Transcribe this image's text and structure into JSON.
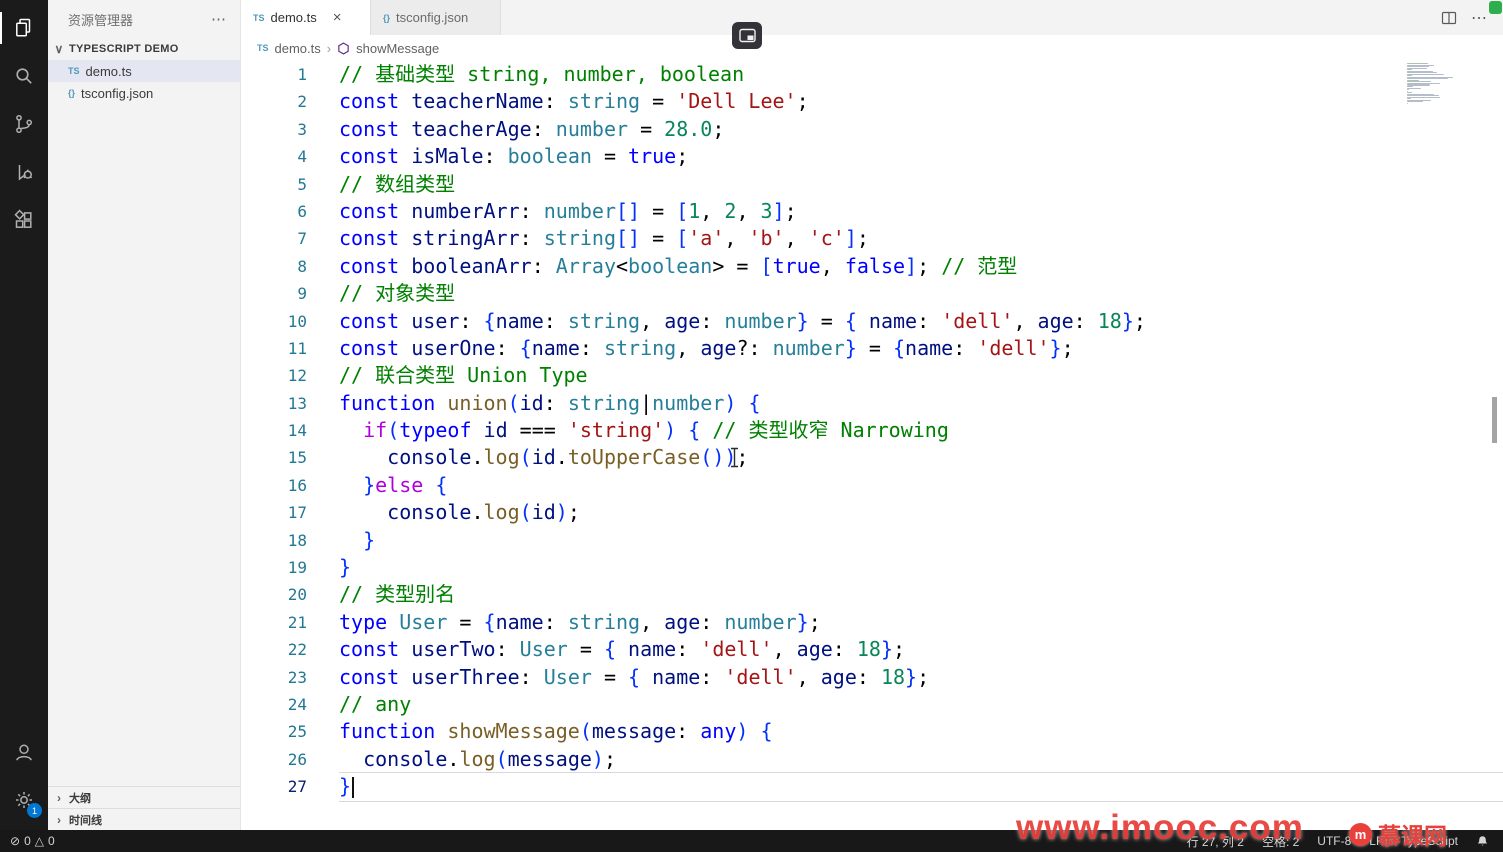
{
  "icons": {
    "ts": "TS",
    "json": "{}",
    "close": "×",
    "more": "⋯",
    "chevron_down": "∨",
    "chevron_right": "›",
    "breadcrumb_sep": "›",
    "error": "⊘",
    "warning": "△",
    "logo_glyph": "m"
  },
  "colors": {
    "seti_blue": "#519aba",
    "badge_blue": "#0078d4",
    "selection": "#e4e6f1",
    "watermark_red": "#e8413c"
  },
  "activity_bar": {
    "settings_badge": "1"
  },
  "sidebar": {
    "title": "资源管理器",
    "section": "TYPESCRIPT DEMO",
    "files": [
      {
        "label": "demo.ts"
      },
      {
        "label": "tsconfig.json"
      }
    ],
    "panels": [
      {
        "label": "大纲"
      },
      {
        "label": "时间线"
      }
    ]
  },
  "tabs": [
    {
      "label": "demo.ts"
    },
    {
      "label": "tsconfig.json"
    }
  ],
  "breadcrumb": {
    "file": "demo.ts",
    "symbol": "showMessage"
  },
  "editor": {
    "cursor": {
      "line": 27,
      "col": 2
    },
    "lines": [
      [
        [
          "// 基础类型 string, number, boolean",
          "c"
        ]
      ],
      [
        [
          "const",
          "k"
        ],
        [
          " "
        ],
        [
          "teacherName",
          "v"
        ],
        [
          ": "
        ],
        [
          "string",
          "t"
        ],
        [
          " = "
        ],
        [
          "'Dell Lee'",
          "s"
        ],
        [
          ";"
        ]
      ],
      [
        [
          "const",
          "k"
        ],
        [
          " "
        ],
        [
          "teacherAge",
          "v"
        ],
        [
          ": "
        ],
        [
          "number",
          "t"
        ],
        [
          " = "
        ],
        [
          "28.0",
          "n"
        ],
        [
          ";"
        ]
      ],
      [
        [
          "const",
          "k"
        ],
        [
          " "
        ],
        [
          "isMale",
          "v"
        ],
        [
          ": "
        ],
        [
          "boolean",
          "t"
        ],
        [
          " = "
        ],
        [
          "true",
          "k"
        ],
        [
          ";"
        ]
      ],
      [
        [
          "// 数组类型",
          "c"
        ]
      ],
      [
        [
          "const",
          "k"
        ],
        [
          " "
        ],
        [
          "numberArr",
          "v"
        ],
        [
          ": "
        ],
        [
          "number",
          "t"
        ],
        [
          "[]",
          "b"
        ],
        [
          " = "
        ],
        [
          "[",
          "b"
        ],
        [
          "1",
          "n"
        ],
        [
          ", "
        ],
        [
          "2",
          "n"
        ],
        [
          ", "
        ],
        [
          "3",
          "n"
        ],
        [
          "]",
          "b"
        ],
        [
          ";"
        ]
      ],
      [
        [
          "const",
          "k"
        ],
        [
          " "
        ],
        [
          "stringArr",
          "v"
        ],
        [
          ": "
        ],
        [
          "string",
          "t"
        ],
        [
          "[]",
          "b"
        ],
        [
          " = "
        ],
        [
          "[",
          "b"
        ],
        [
          "'a'",
          "s"
        ],
        [
          ", "
        ],
        [
          "'b'",
          "s"
        ],
        [
          ", "
        ],
        [
          "'c'",
          "s"
        ],
        [
          "]",
          "b"
        ],
        [
          ";"
        ]
      ],
      [
        [
          "const",
          "k"
        ],
        [
          " "
        ],
        [
          "booleanArr",
          "v"
        ],
        [
          ": "
        ],
        [
          "Array",
          "t"
        ],
        [
          "<"
        ],
        [
          "boolean",
          "t"
        ],
        [
          "> = "
        ],
        [
          "[",
          "b"
        ],
        [
          "true",
          "k"
        ],
        [
          ", "
        ],
        [
          "false",
          "k"
        ],
        [
          "]",
          "b"
        ],
        [
          "; "
        ],
        [
          "// 范型",
          "c"
        ]
      ],
      [
        [
          "// 对象类型",
          "c"
        ]
      ],
      [
        [
          "const",
          "k"
        ],
        [
          " "
        ],
        [
          "user",
          "v"
        ],
        [
          ": "
        ],
        [
          "{",
          "b"
        ],
        [
          "name",
          "v"
        ],
        [
          ": "
        ],
        [
          "string",
          "t"
        ],
        [
          ", "
        ],
        [
          "age",
          "v"
        ],
        [
          ": "
        ],
        [
          "number",
          "t"
        ],
        [
          "}",
          "b"
        ],
        [
          " = "
        ],
        [
          "{",
          "b"
        ],
        [
          " "
        ],
        [
          "name",
          "v"
        ],
        [
          ": "
        ],
        [
          "'dell'",
          "s"
        ],
        [
          ", "
        ],
        [
          "age",
          "v"
        ],
        [
          ": "
        ],
        [
          "18",
          "n"
        ],
        [
          "}",
          "b"
        ],
        [
          ";"
        ]
      ],
      [
        [
          "const",
          "k"
        ],
        [
          " "
        ],
        [
          "userOne",
          "v"
        ],
        [
          ": "
        ],
        [
          "{",
          "b"
        ],
        [
          "name",
          "v"
        ],
        [
          ": "
        ],
        [
          "string",
          "t"
        ],
        [
          ", "
        ],
        [
          "age",
          "v"
        ],
        [
          "?: "
        ],
        [
          "number",
          "t"
        ],
        [
          "}",
          "b"
        ],
        [
          " = "
        ],
        [
          "{",
          "b"
        ],
        [
          "name",
          "v"
        ],
        [
          ": "
        ],
        [
          "'dell'",
          "s"
        ],
        [
          "}",
          "b"
        ],
        [
          ";"
        ]
      ],
      [
        [
          "// 联合类型 Union Type",
          "c"
        ]
      ],
      [
        [
          "function",
          "k"
        ],
        [
          " "
        ],
        [
          "union",
          "f"
        ],
        [
          "(",
          "b"
        ],
        [
          "id",
          "v"
        ],
        [
          ": "
        ],
        [
          "string",
          "t"
        ],
        [
          "|"
        ],
        [
          "number",
          "t"
        ],
        [
          ")",
          "b"
        ],
        [
          " "
        ],
        [
          "{",
          "b"
        ]
      ],
      [
        [
          "  "
        ],
        [
          "if",
          "o"
        ],
        [
          "(",
          "b"
        ],
        [
          "typeof",
          "k"
        ],
        [
          " "
        ],
        [
          "id",
          "v"
        ],
        [
          " === "
        ],
        [
          "'string'",
          "s"
        ],
        [
          ")",
          "b"
        ],
        [
          " "
        ],
        [
          "{",
          "b"
        ],
        [
          " "
        ],
        [
          "// 类型收窄 Narrowing",
          "c"
        ]
      ],
      [
        [
          "    "
        ],
        [
          "console",
          "v"
        ],
        [
          "."
        ],
        [
          "log",
          "f"
        ],
        [
          "(",
          "b"
        ],
        [
          "id",
          "v"
        ],
        [
          "."
        ],
        [
          "toUpperCase",
          "f"
        ],
        [
          "()",
          "b"
        ],
        [
          ")",
          "b"
        ],
        [
          ";"
        ]
      ],
      [
        [
          "  "
        ],
        [
          "}",
          "b"
        ],
        [
          "else",
          "o"
        ],
        [
          " "
        ],
        [
          "{",
          "b"
        ]
      ],
      [
        [
          "    "
        ],
        [
          "console",
          "v"
        ],
        [
          "."
        ],
        [
          "log",
          "f"
        ],
        [
          "(",
          "b"
        ],
        [
          "id",
          "v"
        ],
        [
          ")",
          "b"
        ],
        [
          ";"
        ]
      ],
      [
        [
          "  "
        ],
        [
          "}",
          "b"
        ]
      ],
      [
        [
          "}",
          "b"
        ]
      ],
      [
        [
          "// 类型别名",
          "c"
        ]
      ],
      [
        [
          "type",
          "k"
        ],
        [
          " "
        ],
        [
          "User",
          "t"
        ],
        [
          " = "
        ],
        [
          "{",
          "b"
        ],
        [
          "name",
          "v"
        ],
        [
          ": "
        ],
        [
          "string",
          "t"
        ],
        [
          ", "
        ],
        [
          "age",
          "v"
        ],
        [
          ": "
        ],
        [
          "number",
          "t"
        ],
        [
          "}",
          "b"
        ],
        [
          ";"
        ]
      ],
      [
        [
          "const",
          "k"
        ],
        [
          " "
        ],
        [
          "userTwo",
          "v"
        ],
        [
          ": "
        ],
        [
          "User",
          "t"
        ],
        [
          " = "
        ],
        [
          "{",
          "b"
        ],
        [
          " "
        ],
        [
          "name",
          "v"
        ],
        [
          ": "
        ],
        [
          "'dell'",
          "s"
        ],
        [
          ", "
        ],
        [
          "age",
          "v"
        ],
        [
          ": "
        ],
        [
          "18",
          "n"
        ],
        [
          "}",
          "b"
        ],
        [
          ";"
        ]
      ],
      [
        [
          "const",
          "k"
        ],
        [
          " "
        ],
        [
          "userThree",
          "v"
        ],
        [
          ": "
        ],
        [
          "User",
          "t"
        ],
        [
          " = "
        ],
        [
          "{",
          "b"
        ],
        [
          " "
        ],
        [
          "name",
          "v"
        ],
        [
          ": "
        ],
        [
          "'dell'",
          "s"
        ],
        [
          ", "
        ],
        [
          "age",
          "v"
        ],
        [
          ": "
        ],
        [
          "18",
          "n"
        ],
        [
          "}",
          "b"
        ],
        [
          ";"
        ]
      ],
      [
        [
          "// any",
          "c"
        ]
      ],
      [
        [
          "function",
          "k"
        ],
        [
          " "
        ],
        [
          "showMessage",
          "f"
        ],
        [
          "(",
          "b"
        ],
        [
          "message",
          "v"
        ],
        [
          ": "
        ],
        [
          "any",
          "k"
        ],
        [
          ")",
          "b"
        ],
        [
          " "
        ],
        [
          "{",
          "b"
        ]
      ],
      [
        [
          "  "
        ],
        [
          "console",
          "v"
        ],
        [
          "."
        ],
        [
          "log",
          "f"
        ],
        [
          "(",
          "b"
        ],
        [
          "message",
          "v"
        ],
        [
          ")",
          "b"
        ],
        [
          ";"
        ]
      ],
      [
        [
          "}",
          "b"
        ]
      ]
    ]
  },
  "status_bar": {
    "errors": "0",
    "warnings": "0",
    "line_col": "行 27, 列 2",
    "indent": "空格: 2",
    "encoding": "UTF-8",
    "eol": "LF",
    "language": "TypeScript"
  },
  "watermark": {
    "url": "www.imooc.com",
    "brand": "慕课网"
  }
}
